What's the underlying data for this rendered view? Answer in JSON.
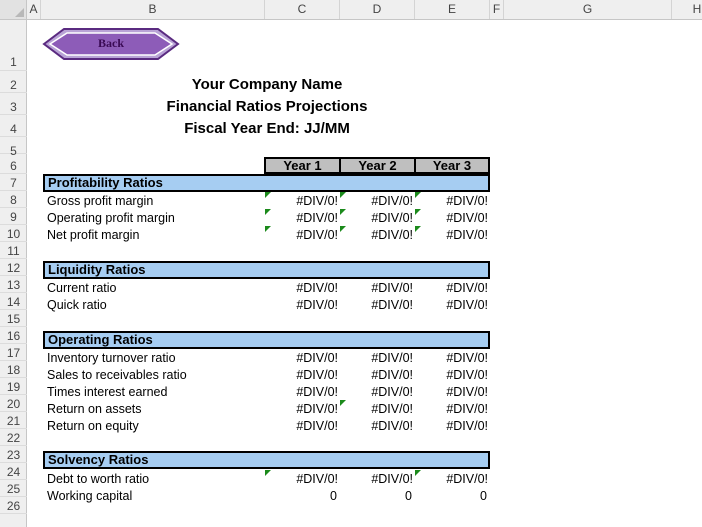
{
  "columns": [
    "A",
    "B",
    "C",
    "D",
    "E",
    "F",
    "G",
    "H"
  ],
  "rows": [
    "1",
    "2",
    "3",
    "4",
    "5",
    "6",
    "7",
    "8",
    "9",
    "10",
    "11",
    "12",
    "13",
    "14",
    "15",
    "16",
    "17",
    "18",
    "19",
    "20",
    "21",
    "22",
    "23",
    "24",
    "25",
    "26"
  ],
  "back_button": "Back",
  "title": {
    "company": "Your Company Name",
    "report": "Financial Ratios Projections",
    "fiscal": "Fiscal Year End: JJ/MM"
  },
  "years": [
    "Year 1",
    "Year 2",
    "Year 3"
  ],
  "sections": {
    "profitability": {
      "header": "Profitability Ratios",
      "items": [
        {
          "label": "Gross profit margin",
          "v": [
            "#DIV/0!",
            "#DIV/0!",
            "#DIV/0!"
          ]
        },
        {
          "label": "Operating profit margin",
          "v": [
            "#DIV/0!",
            "#DIV/0!",
            "#DIV/0!"
          ]
        },
        {
          "label": "Net profit margin",
          "v": [
            "#DIV/0!",
            "#DIV/0!",
            "#DIV/0!"
          ]
        }
      ]
    },
    "liquidity": {
      "header": "Liquidity Ratios",
      "items": [
        {
          "label": "Current ratio",
          "v": [
            "#DIV/0!",
            "#DIV/0!",
            "#DIV/0!"
          ]
        },
        {
          "label": "Quick ratio",
          "v": [
            "#DIV/0!",
            "#DIV/0!",
            "#DIV/0!"
          ]
        }
      ]
    },
    "operating": {
      "header": "Operating Ratios",
      "items": [
        {
          "label": "Inventory turnover ratio",
          "v": [
            "#DIV/0!",
            "#DIV/0!",
            "#DIV/0!"
          ]
        },
        {
          "label": "Sales to receivables ratio",
          "v": [
            "#DIV/0!",
            "#DIV/0!",
            "#DIV/0!"
          ]
        },
        {
          "label": "Times interest earned",
          "v": [
            "#DIV/0!",
            "#DIV/0!",
            "#DIV/0!"
          ]
        },
        {
          "label": "Return on assets",
          "v": [
            "#DIV/0!",
            "#DIV/0!",
            "#DIV/0!"
          ]
        },
        {
          "label": "Return on equity",
          "v": [
            "#DIV/0!",
            "#DIV/0!",
            "#DIV/0!"
          ]
        }
      ]
    },
    "solvency": {
      "header": "Solvency Ratios",
      "items": [
        {
          "label": "Debt to worth ratio",
          "v": [
            "#DIV/0!",
            "#DIV/0!",
            "#DIV/0!"
          ]
        },
        {
          "label": "Working capital",
          "v": [
            "0",
            "0",
            "0"
          ]
        }
      ]
    }
  },
  "colors": {
    "section_fill": "#a6cdf2",
    "year_fill": "#bfbfbf",
    "error_flag": "#1b8a1b",
    "button": "#7b3fa0"
  }
}
